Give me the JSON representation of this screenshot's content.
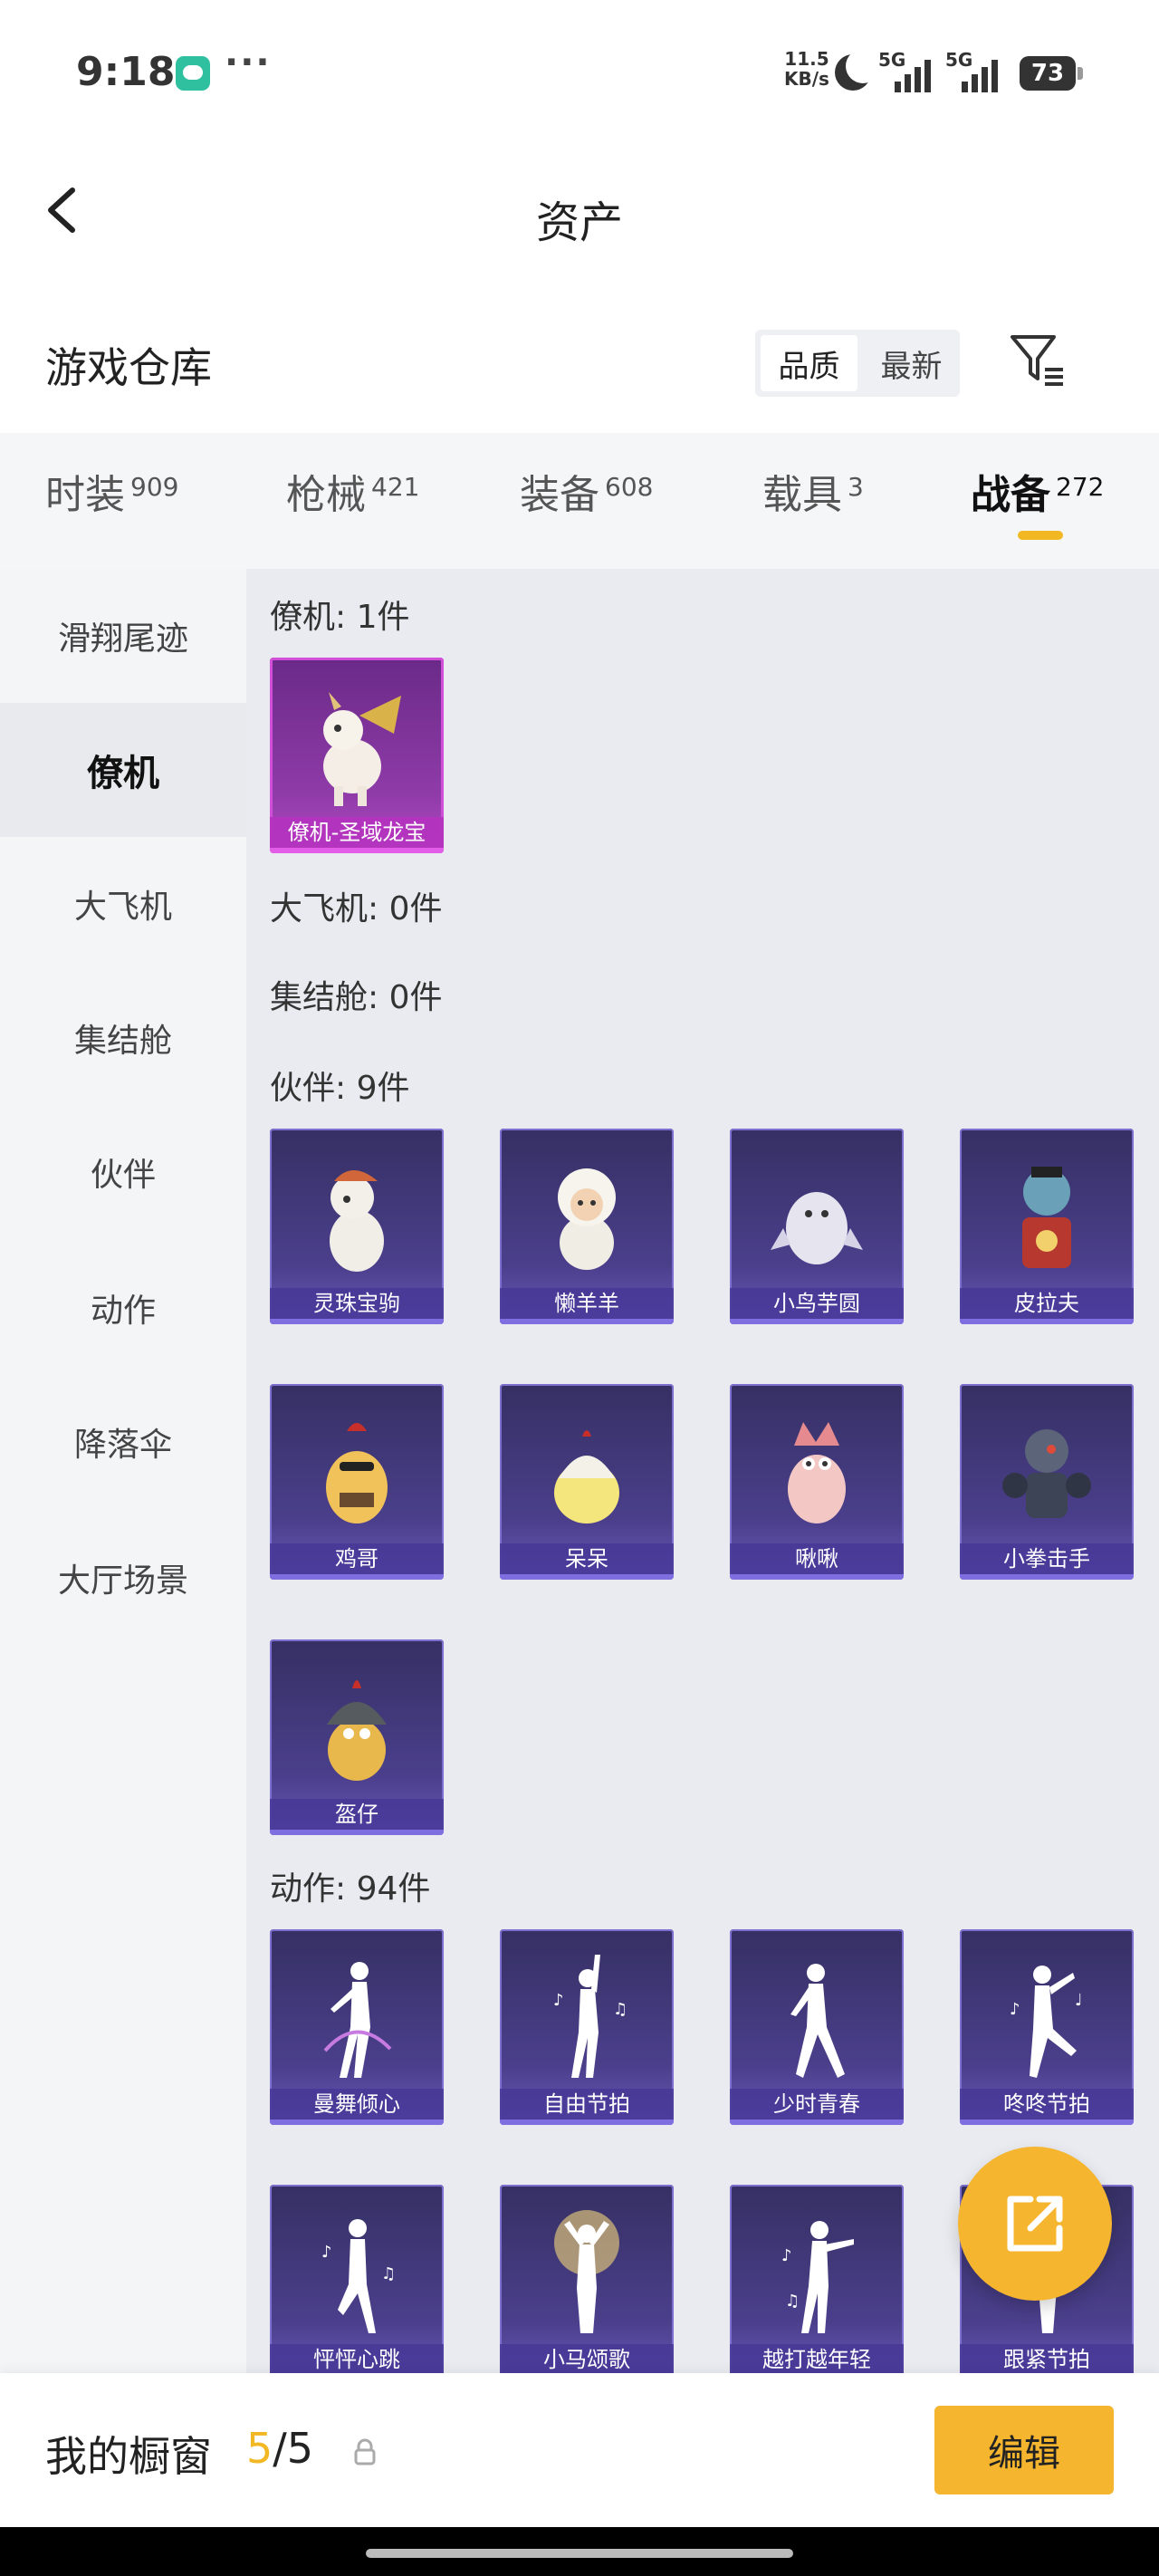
{
  "status_bar": {
    "time": "9:18",
    "dots": "···",
    "net_speed_value": "11.5",
    "net_speed_unit": "KB/s",
    "signal1": "5G",
    "signal2": "5G",
    "battery": "73"
  },
  "header": {
    "title": "资产",
    "back_icon": "chevron-left-icon"
  },
  "section": {
    "title": "游戏仓库",
    "sort_options": [
      "品质",
      "最新"
    ],
    "active_sort": "品质",
    "filter_icon": "filter-icon"
  },
  "tabs": [
    {
      "label": "时装",
      "count": "909"
    },
    {
      "label": "枪械",
      "count": "421"
    },
    {
      "label": "装备",
      "count": "608"
    },
    {
      "label": "载具",
      "count": "3"
    },
    {
      "label": "战备",
      "count": "272"
    }
  ],
  "active_tab": "战备",
  "sidebar": {
    "items": [
      "滑翔尾迹",
      "僚机",
      "大飞机",
      "集结舱",
      "伙伴",
      "动作",
      "降落伞",
      "大厅场景"
    ],
    "active": "僚机"
  },
  "groups": {
    "wingman": {
      "label": "僚机: 1件",
      "items": [
        "僚机-圣域龙宝"
      ]
    },
    "big_plane": {
      "label": "大飞机: 0件"
    },
    "assembly_pod": {
      "label": "集结舱: 0件"
    },
    "companion": {
      "label": "伙伴: 9件",
      "items": [
        "灵珠宝驹",
        "懒羊羊",
        "小鸟芋圆",
        "皮拉夫",
        "鸡哥",
        "呆呆",
        "啾啾",
        "小拳击手",
        "盔仔"
      ]
    },
    "emote": {
      "label": "动作: 94件",
      "items": [
        "曼舞倾心",
        "自由节拍",
        "少时青春",
        "咚咚节拍",
        "怦怦心跳",
        "小马颂歌",
        "越打越年轻",
        "跟紧节拍"
      ]
    }
  },
  "bottom_bar": {
    "label": "我的橱窗",
    "current": "5",
    "separator": "/",
    "total": "5",
    "edit_label": "编辑"
  },
  "colors": {
    "accent": "#f5b52e",
    "card_blue": "#4b3f8c",
    "card_purple": "#b64ac4"
  }
}
